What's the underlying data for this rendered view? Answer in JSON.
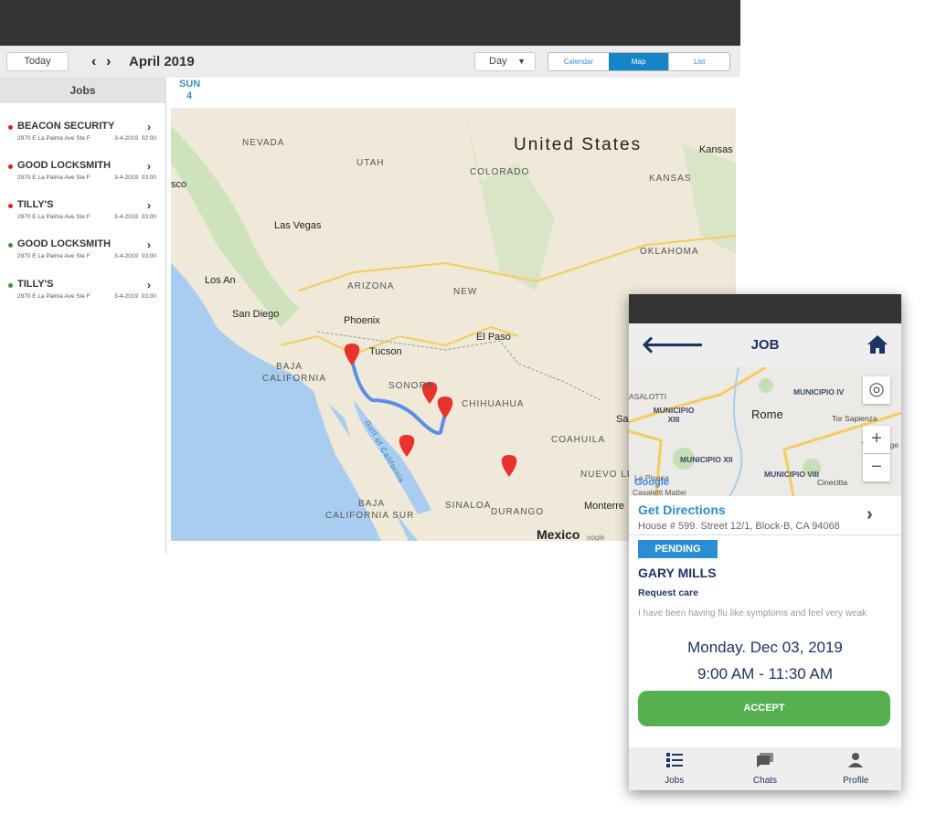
{
  "toolbar": {
    "today": "Today",
    "prev": "‹",
    "next": "›",
    "month": "April 2019",
    "view_select": "Day",
    "tabs": [
      {
        "label": "Calendar",
        "active": false
      },
      {
        "label": "Map",
        "active": true
      },
      {
        "label": "List",
        "active": false
      }
    ]
  },
  "sidebar": {
    "title": "Jobs",
    "jobs": [
      {
        "name": "BEACON SECURITY",
        "address": "2970 E La Palma Ave Ste F",
        "date": "3-4-2019",
        "time": "02:00",
        "status_color": "#e02020"
      },
      {
        "name": "GOOD LOCKSMITH",
        "address": "2970 E La Palma Ave Ste F",
        "date": "3-4-2019",
        "time": "03:00",
        "status_color": "#e02020"
      },
      {
        "name": "TILLY'S",
        "address": "2970 E La Palma Ave Ste F",
        "date": "3-4-2019",
        "time": "03:00",
        "status_color": "#e02020"
      },
      {
        "name": "GOOD LOCKSMITH",
        "address": "2970 E La Palma Ave Ste F",
        "date": "3-4-2019",
        "time": "03:00",
        "status_color": "#3a9a3a"
      },
      {
        "name": "TILLY'S",
        "address": "2970 E La Palma Ave Ste F",
        "date": "3-4-2019",
        "time": "03:00",
        "status_color": "#3a9a3a"
      }
    ]
  },
  "day_header": {
    "weekday": "SUN",
    "day": "4"
  },
  "map": {
    "labels": [
      "United States",
      "NEVADA",
      "UTAH",
      "COLORADO",
      "KANSAS",
      "Kansas",
      "Las Vegas",
      "OKLAHOMA",
      "Los An",
      "ARIZONA",
      "NEW",
      "San Diego",
      "Phoenix",
      "Tucson",
      "El Paso",
      "BAJA",
      "CALIFORNIA",
      "SONORA",
      "CHIHUAHUA",
      "Gulf of California",
      "COAHUILA",
      "NUEVO LE",
      "BAJA",
      "CALIFORNIA SUR",
      "SINALOA",
      "DURANGO",
      "Monterre",
      "Mexico",
      "sco",
      "Sa",
      "oogle"
    ]
  },
  "phone": {
    "title": "JOB",
    "map_labels": [
      "MUNICIPIO IV",
      "MUNICIPIO XIII",
      "Rome",
      "Tor Sapienza",
      "MUNICIPIO XII",
      "MUNICIPIO VIII",
      "Cinecitta",
      "ASALOTTI",
      "La Pisana",
      "Casaletti Mattei",
      "Torre Ange",
      "Google"
    ],
    "directions_label": "Get Directions",
    "address": "House # 599. Street 12/1, Block-B, CA 94068",
    "status": "PENDING",
    "customer": "GARY MILLS",
    "request_title": "Request care",
    "request_text": "I have been having flu like symptoms and feel very weak",
    "date": "Monday. Dec 03, 2019",
    "time": "9:00 AM - 11:30 AM",
    "accept": "ACCEPT",
    "nav": [
      {
        "label": "Jobs",
        "icon": "list-icon"
      },
      {
        "label": "Chats",
        "icon": "chat-icon"
      },
      {
        "label": "Profile",
        "icon": "person-icon"
      }
    ]
  },
  "colors": {
    "accent": "#1585c8",
    "navy": "#1e3462",
    "accept": "#57b050",
    "pin": "#e8322b",
    "route": "#5b8ee6"
  }
}
